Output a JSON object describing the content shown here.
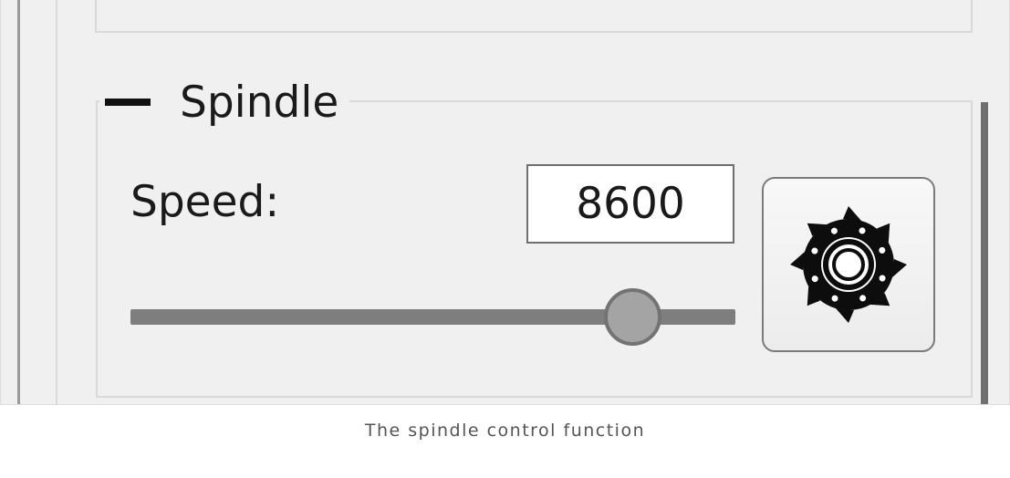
{
  "spindle_group": {
    "title": "Spindle",
    "collapse_icon": "minus-icon",
    "speed_label": "Speed:",
    "speed_value": "8600",
    "speed_slider_fraction": 0.83,
    "toggle_button_icon": "spindle-cutter-icon"
  },
  "caption": "The spindle control function"
}
